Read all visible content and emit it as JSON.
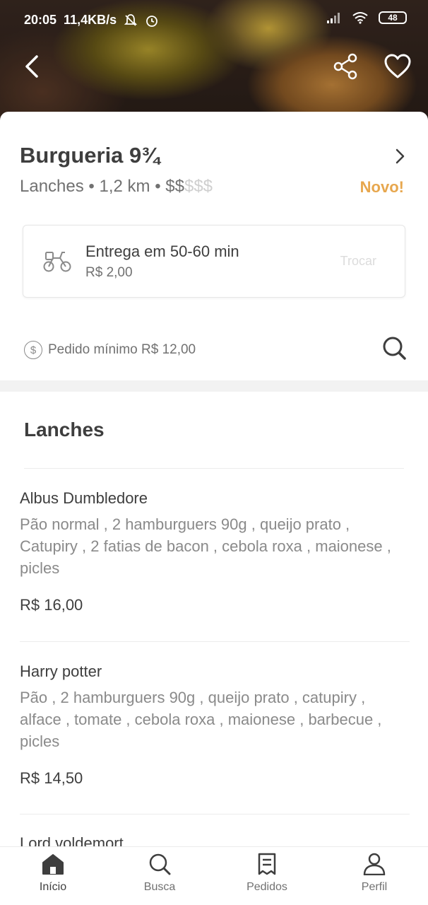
{
  "status_bar": {
    "time": "20:05",
    "speed": "11,4KB/s",
    "battery": "48"
  },
  "store": {
    "name": "Burgueria 9¾",
    "category": "Lanches",
    "distance": "1,2 km",
    "price_level_on": "$$",
    "price_level_off": "$$$",
    "badge": "Novo!"
  },
  "delivery": {
    "title": "Entrega em 50-60 min",
    "fee": "R$ 2,00",
    "action": "Trocar"
  },
  "minimum_order": "Pedido mínimo R$ 12,00",
  "section_title": "Lanches",
  "items": [
    {
      "name": "Albus Dumbledore",
      "description": "Pão normal , 2 hamburguers 90g , queijo prato , Catupiry , 2 fatias de bacon , cebola roxa , maionese , picles",
      "price": "R$ 16,00"
    },
    {
      "name": "Harry potter",
      "description": "Pão , 2 hamburguers 90g , queijo prato , catupiry , alface , tomate , cebola roxa , maionese , barbecue ,  picles",
      "price": "R$ 14,50"
    },
    {
      "name": "Lord voldemort"
    }
  ],
  "nav": {
    "home": "Início",
    "search": "Busca",
    "orders": "Pedidos",
    "profile": "Perfil"
  },
  "colors": {
    "accent_badge": "#e7a74e",
    "text_primary": "#3e3e3e",
    "text_secondary": "#717171"
  }
}
